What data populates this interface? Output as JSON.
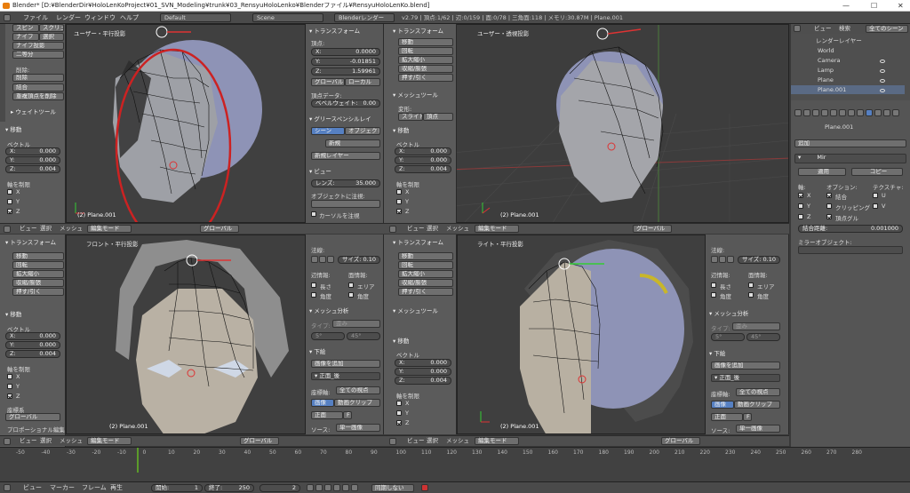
{
  "titlebar": {
    "text": "Blender* [D:¥BlenderDir¥HoloLenKoProject¥01_SVN_Modeling¥trunk¥03_RensyuHoloLenko¥Blenderファイル¥RensyuHoloLenKo.blend]",
    "minimize": "—",
    "maximize": "☐",
    "close": "✕"
  },
  "info_header": {
    "menus": [
      "ファイル",
      "レンダー",
      "ウィンドウ",
      "ヘルプ"
    ],
    "layout": "Default",
    "scene": "Scene",
    "engine": "Blenderレンダー",
    "stats": "v2.79 | 頂点:1/62 | 辺:0/159 | 面:0/78 | 三角面:118 | メモリ:30.87M | Plane.001"
  },
  "toolshelf_top": {
    "tools": [
      [
        "スピン",
        "スクリュー"
      ],
      [
        "ナイフ",
        "選択"
      ],
      [
        "ナイフ投影"
      ],
      [
        "二等分"
      ]
    ],
    "delete_label": "削除:",
    "delete_button": "削除",
    "merge_button": "結合",
    "remove_doubles": "重複頂点を削除",
    "weight_tools": "ウェイトツール",
    "move_section": "移動",
    "vector_label": "ベクトル",
    "x": "X:",
    "y": "Y:",
    "z": "Z:",
    "x_val": "0.000",
    "y_val": "0.000",
    "z_val": "0.004",
    "axis_limit": "軸を制限",
    "axes": [
      "X",
      "Y",
      "Z"
    ]
  },
  "properties_top": {
    "transform_section": "トランスフォーム",
    "vertex_label": "頂点:",
    "x": "X:",
    "y": "Y:",
    "z": "Z:",
    "x_val": "0.0000",
    "y_val": "-0.01851",
    "z_val": "1.59961",
    "global_button": "グローバル",
    "local_button": "ローカル",
    "vertex_data": "頂点データ:",
    "bevel_weight": "ベベルウェイト:",
    "bevel_val": "0.00",
    "grease_section": "グリースペンシルレイ",
    "scene_button": "シーン",
    "object_button": "オブジェクト",
    "new_button": "新規",
    "new_layer": "新規レイヤー",
    "view_section": "ビュー",
    "lens_label": "レンズ:",
    "lens_val": "35.000",
    "lock_object": "オブジェクトに注視:",
    "lock_cursor": "カーソルを注視"
  },
  "viewports": [
    {
      "title": "ユーザー・平行投影",
      "label": "(2) Plane.001"
    },
    {
      "title": "ユーザー・透視投影",
      "label": "(2) Plane.001"
    },
    {
      "title": "フロント・平行投影",
      "label": "(2) Plane.001"
    },
    {
      "title": "ライト・平行投影",
      "label": "(2) Plane.001"
    }
  ],
  "viewport_header": {
    "view": "ビュー",
    "select": "選択",
    "mesh": "メッシュ",
    "mode": "編集モード",
    "orientation": "グローバル"
  },
  "mid_tools": {
    "transform_section": "トランスフォーム",
    "buttons": [
      "移動",
      "回転",
      "拡大縮小",
      "収縮/膨張",
      "押す/引く"
    ],
    "mesh_tools": "メッシュツール",
    "deform": "変形:",
    "slide": "スライド",
    "vertex_btn": "頂点",
    "move_section": "移動",
    "vector_label": "ベクトル",
    "x": "X:",
    "y": "Y:",
    "z": "Z:",
    "x_val": "0.000",
    "y_val": "0.000",
    "z_val": "0.004",
    "axis_limit": "軸を制限",
    "axes": [
      "X",
      "Y",
      "Z"
    ]
  },
  "bottom_left_tools": {
    "transform_section": "トランスフォーム",
    "buttons": [
      "移動",
      "回転",
      "拡大縮小",
      "収縮/膨張",
      "押す/引く"
    ],
    "move_section": "移動",
    "vector_label": "ベクトル",
    "x": "X:",
    "y": "Y:",
    "z": "Z:",
    "x_val": "0.000",
    "y_val": "0.000",
    "z_val": "0.004",
    "axis_limit": "軸を制限",
    "axes": [
      "X",
      "Y",
      "Z"
    ],
    "orientation_label": "座標系",
    "orientation_val": "グローバル",
    "proportional": "プロポーショナル編集"
  },
  "bottom_props": {
    "normals": "法線:",
    "size_label": "サイズ:",
    "size_val": "0.10",
    "edge_info": "辺情報:",
    "face_info": "面情報:",
    "length": "長さ",
    "area": "エリア",
    "angle": "角度",
    "angle2": "角度",
    "mesh_analysis": "メッシュ分析",
    "type_label": "タイプ:",
    "type_val": "歪み",
    "min_val": "5°",
    "max_val": "45°",
    "background_section": "下絵",
    "add_image": "画像を追加",
    "bg_item": "正面_後",
    "axis_label": "座標軸:",
    "axis_val": "全ての視点",
    "image_btn": "画像",
    "movie_btn": "動画クリップ",
    "front_btn": "正面",
    "f_btn": "F",
    "source_label": "ソース:",
    "source_val": "単一画像"
  },
  "outliner": {
    "view": "ビュー",
    "search": "検索",
    "filter": "全てのシーン",
    "items": [
      "レンダーレイヤー",
      "World",
      "Camera",
      "Lamp",
      "Plane",
      "Plane.001"
    ]
  },
  "modifier_props": {
    "object_name": "Plane.001",
    "add_modifier": "追加",
    "modifier_name": "Mir",
    "apply": "適用",
    "copy": "コピー",
    "axis_header": "軸:",
    "options_header": "オプション:",
    "texture_header": "テクスチャ:",
    "x": "X",
    "y": "Y",
    "z": "Z",
    "merge": "結合",
    "clipping": "クリッピング",
    "vertex_groups": "頂点グル",
    "u": "U",
    "v": "V",
    "merge_limit": "結合距離:",
    "merge_limit_val": "0.001000",
    "mirror_object": "ミラーオブジェクト:"
  },
  "timeline": {
    "ticks": [
      "-50",
      "-40",
      "-30",
      "-20",
      "-10",
      "0",
      "10",
      "20",
      "30",
      "40",
      "50",
      "60",
      "70",
      "80",
      "90",
      "100",
      "110",
      "120",
      "130",
      "140",
      "150",
      "160",
      "170",
      "180",
      "190",
      "200",
      "210",
      "220",
      "230",
      "240",
      "250",
      "260",
      "270",
      "280"
    ],
    "view": "ビュー",
    "marker": "マーカー",
    "frame": "フレーム",
    "playback": "再生",
    "start_label": "開始:",
    "start_val": "1",
    "end_label": "終了:",
    "end_val": "250",
    "current_val": "2",
    "sync": "同期しない"
  }
}
